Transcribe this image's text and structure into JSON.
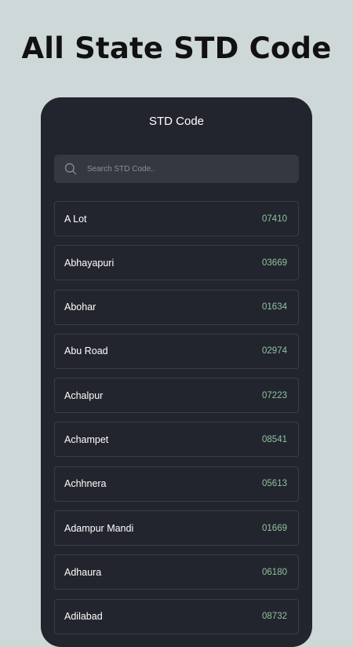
{
  "promo": {
    "title": "All State STD Code"
  },
  "app": {
    "title": "STD Code"
  },
  "search": {
    "placeholder": "Search STD Code..",
    "value": ""
  },
  "colors": {
    "background": "#cfd8d8",
    "card": "#23252e",
    "search_bg": "#363841",
    "code_text": "#8fc29e",
    "row_border": "#3a3d47"
  },
  "list": {
    "items": [
      {
        "name": "A Lot",
        "code": "07410"
      },
      {
        "name": "Abhayapuri",
        "code": "03669"
      },
      {
        "name": "Abohar",
        "code": "01634"
      },
      {
        "name": "Abu Road",
        "code": "02974"
      },
      {
        "name": "Achalpur",
        "code": "07223"
      },
      {
        "name": "Achampet",
        "code": "08541"
      },
      {
        "name": "Achhnera",
        "code": "05613"
      },
      {
        "name": "Adampur Mandi",
        "code": "01669"
      },
      {
        "name": "Adhaura",
        "code": "06180"
      },
      {
        "name": "Adilabad",
        "code": "08732"
      }
    ]
  }
}
